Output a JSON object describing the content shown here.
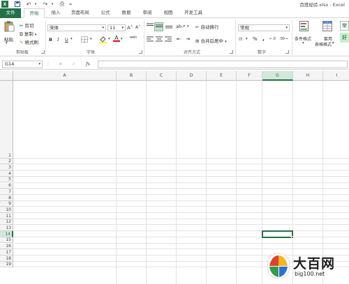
{
  "title_bar": {
    "doc_title": "百度经验.xlsx - Excel"
  },
  "tabs": [
    "文件",
    "开始",
    "插入",
    "页面布局",
    "公式",
    "数据",
    "审阅",
    "视图",
    "开发工具"
  ],
  "ribbon": {
    "clipboard": {
      "paste": "粘贴",
      "cut": "剪切",
      "copy": "复制",
      "format_painter": "格式刷",
      "group": "剪贴板"
    },
    "font": {
      "name": "宋体",
      "size": "11",
      "bold": "B",
      "italic": "I",
      "underline": "U",
      "grow": "A˄",
      "shrink": "A˅",
      "wen": "wén",
      "font_color_glyph": "A",
      "group": "字体"
    },
    "alignment": {
      "wrap_text": "自动换行",
      "merge_center": "合并后居中",
      "group": "对齐方式"
    },
    "number": {
      "format": "常规",
      "percent": "%",
      "comma": ",",
      "group": "数字"
    },
    "styles": {
      "conditional_format": "条件格式",
      "table_format_1": "套用",
      "table_format_2": "表格格式",
      "style_good": "好",
      "style_normal": "常"
    }
  },
  "formula_bar": {
    "name_box": "G14",
    "fx": "fx",
    "cancel": "✕",
    "enter": "✓",
    "value": ""
  },
  "grid": {
    "columns": [
      "A",
      "B",
      "C",
      "D",
      "E",
      "F",
      "G",
      "H",
      "I"
    ],
    "rows": [
      "1",
      "2",
      "3",
      "4",
      "5",
      "6",
      "7",
      "8",
      "9",
      "10",
      "11",
      "12",
      "13",
      "14",
      "15",
      "16",
      "17",
      "18",
      "19"
    ],
    "selected_column": "G",
    "selected_row": "14",
    "active_cell": "G14"
  },
  "watermark": {
    "text": "大百网",
    "url": "big100.net"
  },
  "colors": {
    "accent": "#217346"
  }
}
